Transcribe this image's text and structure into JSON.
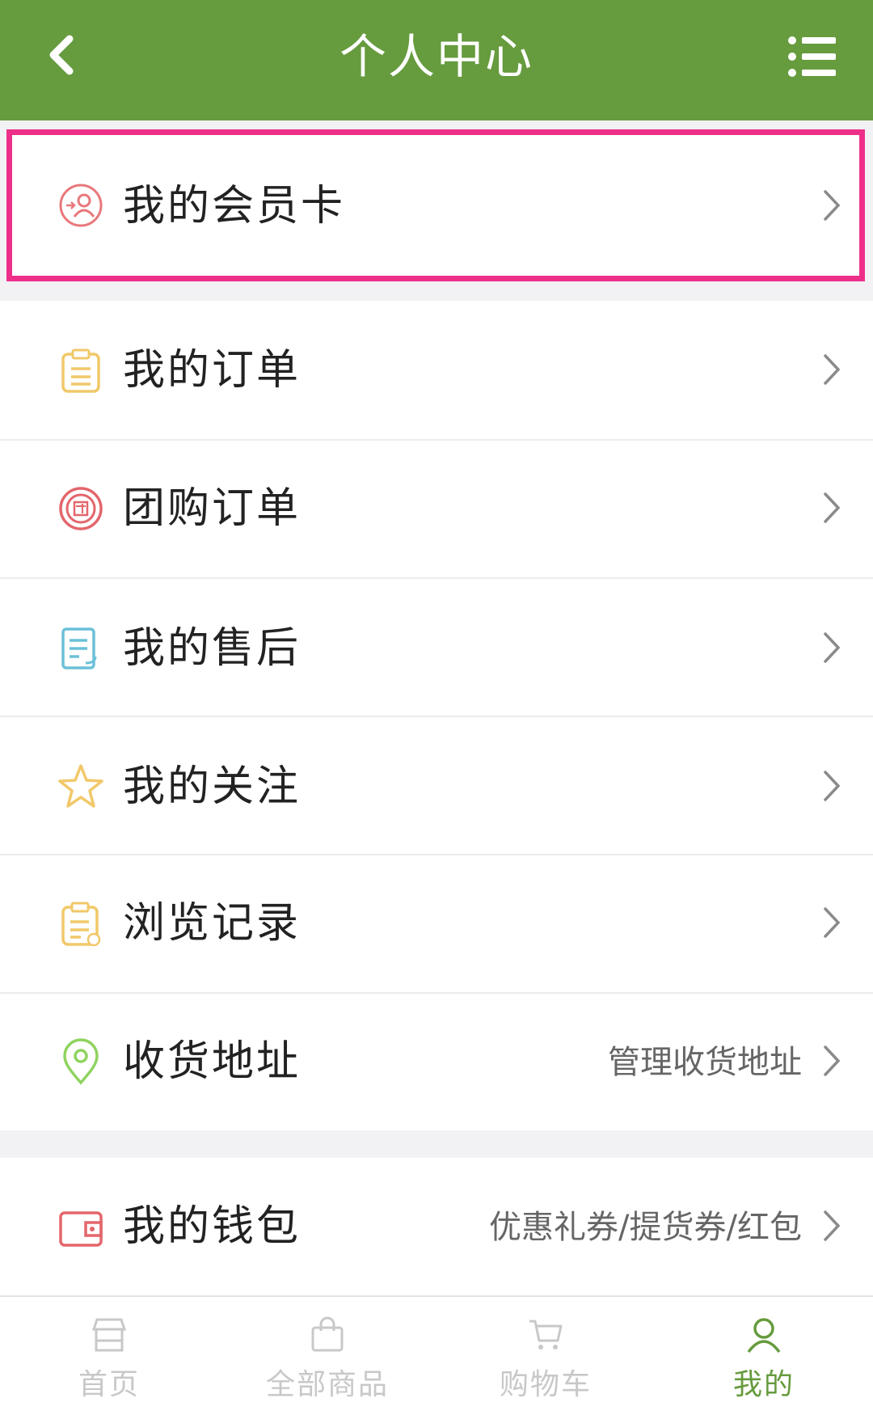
{
  "header": {
    "title": "个人中心",
    "back_icon": "chevron-left-icon",
    "menu_icon": "list-menu-icon"
  },
  "menu": [
    {
      "label": "我的会员卡",
      "icon": "member-card-icon",
      "hint": ""
    },
    {
      "label": "我的订单",
      "icon": "clipboard-icon",
      "hint": ""
    },
    {
      "label": "团购订单",
      "icon": "group-buy-icon",
      "hint": ""
    },
    {
      "label": "我的售后",
      "icon": "after-sales-icon",
      "hint": ""
    },
    {
      "label": "我的关注",
      "icon": "star-icon",
      "hint": ""
    },
    {
      "label": "浏览记录",
      "icon": "history-icon",
      "hint": ""
    },
    {
      "label": "收货地址",
      "icon": "location-pin-icon",
      "hint": "管理收货地址"
    },
    {
      "label": "我的钱包",
      "icon": "wallet-icon",
      "hint": "优惠礼券/提货券/红包"
    }
  ],
  "tabs": [
    {
      "label": "首页",
      "icon": "store-icon"
    },
    {
      "label": "全部商品",
      "icon": "shopping-bag-icon"
    },
    {
      "label": "购物车",
      "icon": "cart-icon"
    },
    {
      "label": "我的",
      "icon": "user-icon",
      "active": true
    }
  ],
  "colors": {
    "brand": "#669b3e",
    "highlight": "#ee2f8a"
  }
}
